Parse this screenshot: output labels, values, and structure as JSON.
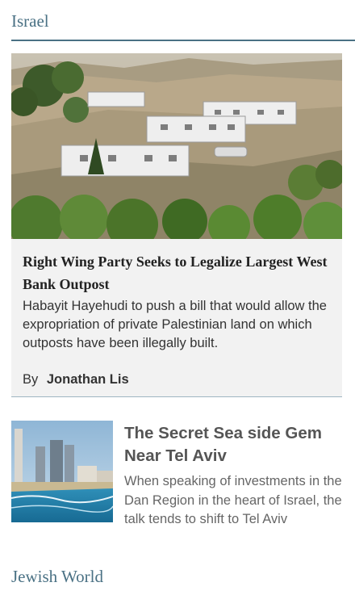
{
  "section": {
    "title": "Israel"
  },
  "featured": {
    "title": "Right Wing Party Seeks to Legalize Largest West Bank Outpost",
    "summary": "Habayit Hayehudi to push a bill that would allow the expropriation of private Palestinian land on which outposts have been illegally built.",
    "byline_prefix": "By",
    "author": "Jonathan Lis"
  },
  "story2": {
    "title": "The Secret Sea side Gem Near Tel Aviv",
    "summary": "When speaking of investments in the Dan Region in the heart of Israel, the talk tends to shift to Tel Aviv"
  },
  "next_section": {
    "title": "Jewish World"
  },
  "colors": {
    "section_accent": "#4a7184",
    "card_background": "#f2f2f2"
  }
}
